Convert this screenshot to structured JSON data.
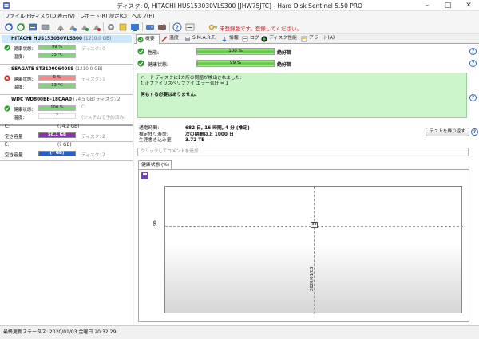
{
  "window": {
    "title": "ディスク: 0, HITACHI HUS153030VLS300 [JHW75JTC]  -  Hard Disk Sentinel 5.50 PRO"
  },
  "menu": [
    "ファイル(F)",
    "ディスク(D)",
    "表示(V)",
    "レポート(R)",
    "設定(C)",
    "ヘルプ(H)"
  ],
  "toolbar": {
    "unregistered": "未登録版です。登録してください。"
  },
  "disks": [
    {
      "name": "HITACHI HUS153030VLS300",
      "size": "(1210.0 GB)",
      "status": "good",
      "health_label": "健康状態:",
      "health_value": "99 %",
      "health_pct": 99,
      "disk_note": "ディスク: 0",
      "temp_label": "温度:",
      "temp_value": "35 °C"
    },
    {
      "name": "SEAGATE ST31000640SS",
      "size": "(1210.0 GB)",
      "status": "bad",
      "health_label": "健康状態:",
      "health_value": "0 %",
      "health_pct": 0,
      "disk_note": "ディスク: 1",
      "temp_label": "温度:",
      "temp_value": "33 °C"
    },
    {
      "name": "WDC WD800BB-18CAA0",
      "size": "(74.5 GB)",
      "disk_head_note": "ディスク: 2",
      "status": "good",
      "health_label": "健康状態:",
      "health_value": "100 %",
      "health_pct": 100,
      "disk_note": "C:",
      "temp_label": "温度:",
      "temp_value": "?",
      "temp_note": "(システムで予約済み)"
    }
  ],
  "volumes": [
    {
      "letter": "C:",
      "size": "(74.2 GB)",
      "free_label": "空き容量",
      "free_value": "58.1 GB",
      "disk_note": "ディスク: 2",
      "color": "#7a2da8"
    },
    {
      "letter": "E:",
      "size": "(? GB)",
      "free_label": "空き容量",
      "free_value": "(? GB)",
      "disk_note": "ディスク: 2",
      "color": "#2b5fbf"
    }
  ],
  "tabs": [
    {
      "label": "概要",
      "active": true
    },
    {
      "label": "温度"
    },
    {
      "label": "S.M.A.R.T."
    },
    {
      "label": "情報"
    },
    {
      "label": "ログ"
    },
    {
      "label": "ディスク性能"
    },
    {
      "label": "アラート(A)"
    }
  ],
  "overview": {
    "perf_label": "性能:",
    "perf_value": "100 %",
    "perf_pct": 100,
    "perf_rating": "絶好調",
    "health_label": "健康状態:",
    "health_value": "99 %",
    "health_pct": 99,
    "health_rating": "絶好調",
    "message_lines": [
      "ハード ディスクに1カ所の問題が検出されました:",
      "訂正ファイリスベリファイ エラー合計 = 1"
    ],
    "message_bold": "何もする必要はありません。",
    "stats": [
      {
        "key": "通電時間:",
        "value": "682 日, 16 時間, 4 分 (推定)"
      },
      {
        "key": "推定残り寿命:",
        "value": "次の期間以上 1000 日"
      },
      {
        "key": "生涯書き込み量:",
        "value": "3.72 TB"
      }
    ],
    "test_button": "テストを繰り返す",
    "comment_placeholder": "クリックしてコメントを追加 ..."
  },
  "chart_data": {
    "type": "line",
    "title": "健康状態 (%)",
    "x": [
      "2020/01/03"
    ],
    "series": [
      {
        "values": [
          99
        ]
      }
    ],
    "xlabel": "",
    "ylabel": "",
    "tick_labels": {
      "y": [
        "99"
      ],
      "x": [
        "2020/01/03"
      ]
    },
    "point_label": "99",
    "grid": true
  },
  "statusbar": {
    "text": "最終更新ステータス:  2020/01/03 金曜日 20:32:29"
  }
}
